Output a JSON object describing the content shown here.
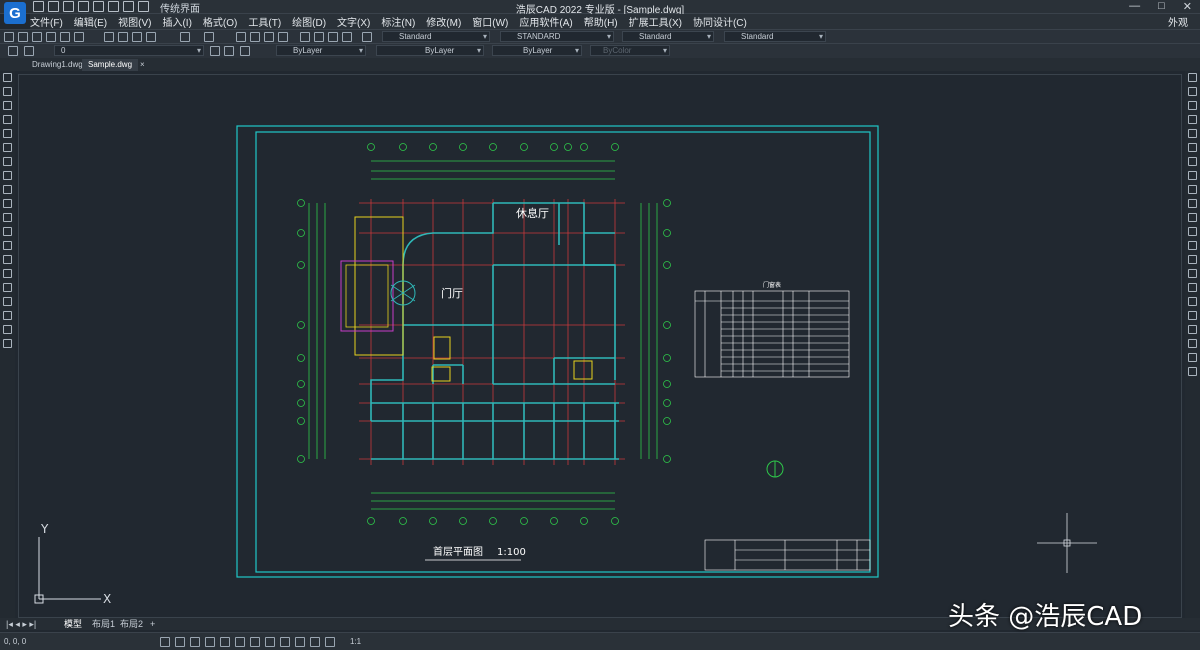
{
  "app": {
    "title": "浩辰CAD 2022 专业版 - [Sample.dwg]",
    "workspace": "传统界面",
    "logo": "G",
    "window_controls": [
      "—",
      "□",
      "✕"
    ]
  },
  "menu": [
    "文件(F)",
    "编辑(E)",
    "视图(V)",
    "插入(I)",
    "格式(O)",
    "工具(T)",
    "绘图(D)",
    "文字(X)",
    "标注(N)",
    "修改(M)",
    "窗口(W)",
    "应用软件(A)",
    "帮助(H)",
    "扩展工具(X)",
    "协同设计(C)"
  ],
  "menu_right": "外观",
  "toolbar": {
    "text_style": "Standard",
    "dim_style": "STANDARD",
    "table_style": "Standard",
    "multileader_style": "Standard",
    "layer": "0",
    "color": "ByLayer",
    "linetype": "ByLayer",
    "lineweight": "ByLayer",
    "plotstyle": "ByColor"
  },
  "doc_tabs": [
    "Drawing1.dwg",
    "Sample.dwg"
  ],
  "active_doc": "Sample.dwg",
  "layout_tabs": [
    "模型",
    "布局1",
    "布局2"
  ],
  "drawing": {
    "room_lounge": "休息厅",
    "room_hall": "门厅",
    "plan_title": "首层平面图",
    "scale_label": "1:100",
    "door_table_title": "门窗表",
    "ucs_y": "Y",
    "ucs_x": "X"
  },
  "status": {
    "coordinates": "0, 0, 0",
    "annotation_scale": "1:1"
  },
  "watermark": "头条 @浩辰CAD",
  "colors": {
    "background": "#212830",
    "frame": "#1fc8c8",
    "grid": "#d23c3c",
    "walls": "#2fb8b8",
    "dims": "#2ec84a",
    "yellow": "#e8d21e"
  }
}
